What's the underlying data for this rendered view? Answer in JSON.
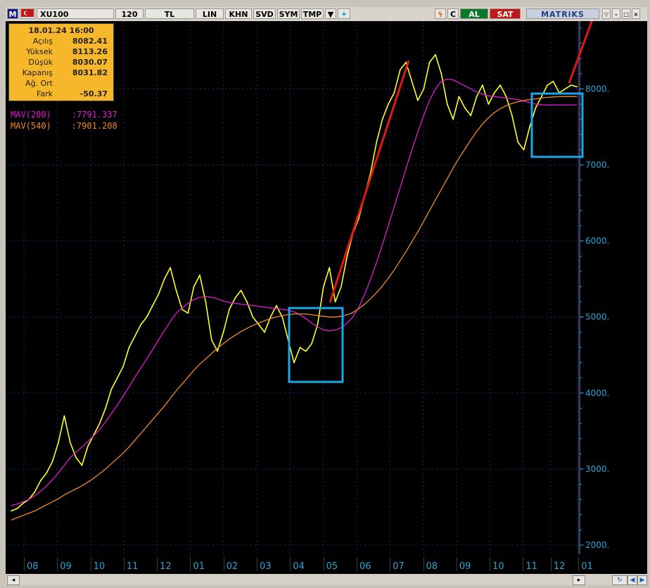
{
  "toolbar": {
    "logo": "M",
    "symbol": "XU100",
    "period": "120",
    "currency": "TL",
    "lin": "LIN",
    "khn": "KHN",
    "svd": "SVD",
    "sym": "SYM",
    "tmp": "TMP",
    "c_label": "C",
    "buy": "AL",
    "sell": "SAT",
    "brand": "MATRiKS"
  },
  "info": {
    "date": "18.01.24 16:00",
    "rows": [
      {
        "label": "Açılış",
        "value": "8082.41"
      },
      {
        "label": "Yüksek",
        "value": "8113.26"
      },
      {
        "label": "Düşük",
        "value": "8030.07"
      },
      {
        "label": "Kapanış",
        "value": "8031.82"
      },
      {
        "label": "Ağ. Ort",
        "value": ""
      },
      {
        "label": "Fark",
        "value": "-50.37"
      }
    ]
  },
  "indicators": {
    "mav200": {
      "label": "MAV(200)",
      "value": ":7791.337",
      "color": "#e01ad0"
    },
    "mav540": {
      "label": "MAV(540)",
      "value": ":7901.208",
      "color": "#f08a28"
    }
  },
  "colors": {
    "price": "#ffff22",
    "mav200": "#e01ad0",
    "mav540": "#f08a28",
    "axis": "#25a5d6",
    "boxes": "#1ea6e8",
    "trend": "#e01818"
  },
  "chart_data": {
    "type": "line",
    "ylim": [
      2000,
      8800
    ],
    "y_ticks": [
      "2000.",
      "3000.",
      "4000.",
      "5000.",
      "6000.",
      "7000.",
      "8000."
    ],
    "y_tick_values": [
      2000,
      3000,
      4000,
      5000,
      6000,
      7000,
      8000
    ],
    "x_ticks": [
      "08",
      "09",
      "10",
      "11",
      "12",
      "01",
      "02",
      "03",
      "04",
      "05",
      "06",
      "07",
      "08",
      "09",
      "10",
      "11",
      "12",
      "01"
    ],
    "n_points": 97,
    "x_tick_indices": [
      0,
      6,
      12,
      18,
      24,
      30,
      36,
      42,
      48,
      54,
      60,
      66,
      72,
      78,
      84,
      90,
      95,
      100
    ],
    "series": [
      {
        "name": "XU100",
        "values": [
          2450,
          2480,
          2550,
          2600,
          2700,
          2850,
          2950,
          3100,
          3350,
          3700,
          3350,
          3150,
          3050,
          3300,
          3450,
          3600,
          3800,
          4050,
          4200,
          4350,
          4600,
          4750,
          4900,
          5000,
          5150,
          5300,
          5500,
          5650,
          5350,
          5100,
          5050,
          5400,
          5550,
          5200,
          4700,
          4550,
          4800,
          5100,
          5250,
          5350,
          5200,
          5000,
          4900,
          4800,
          5000,
          5150,
          5000,
          4700,
          4400,
          4600,
          4550,
          4650,
          4900,
          5400,
          5650,
          5200,
          5400,
          5800,
          6100,
          6300,
          6600,
          6900,
          7300,
          7600,
          7800,
          7950,
          8250,
          8350,
          8100,
          7850,
          8000,
          8350,
          8450,
          8200,
          7800,
          7600,
          7900,
          7750,
          7650,
          7900,
          8050,
          7800,
          7950,
          8050,
          7900,
          7650,
          7300,
          7200,
          7500,
          7750,
          7900,
          8050,
          8100,
          7950,
          8000,
          8050,
          8030
        ]
      },
      {
        "name": "MAV(200)",
        "values": [
          2520,
          2540,
          2570,
          2600,
          2650,
          2710,
          2780,
          2860,
          2950,
          3050,
          3150,
          3220,
          3290,
          3360,
          3440,
          3520,
          3620,
          3730,
          3840,
          3960,
          4080,
          4210,
          4330,
          4450,
          4570,
          4700,
          4820,
          4940,
          5050,
          5120,
          5180,
          5230,
          5260,
          5270,
          5260,
          5240,
          5210,
          5190,
          5180,
          5170,
          5160,
          5150,
          5140,
          5130,
          5120,
          5110,
          5100,
          5090,
          5070,
          5030,
          4980,
          4920,
          4870,
          4830,
          4820,
          4830,
          4860,
          4920,
          5000,
          5130,
          5300,
          5500,
          5720,
          5950,
          6200,
          6450,
          6700,
          6950,
          7200,
          7430,
          7650,
          7850,
          8000,
          8100,
          8130,
          8120,
          8080,
          8040,
          8000,
          7960,
          7930,
          7910,
          7900,
          7890,
          7880,
          7870,
          7860,
          7840,
          7820,
          7800,
          7790,
          7790,
          7790,
          7790,
          7790,
          7791,
          7791
        ]
      },
      {
        "name": "MAV(540)",
        "values": [
          2330,
          2360,
          2390,
          2420,
          2450,
          2490,
          2530,
          2570,
          2610,
          2660,
          2700,
          2740,
          2780,
          2830,
          2880,
          2940,
          3000,
          3070,
          3140,
          3210,
          3290,
          3380,
          3470,
          3560,
          3650,
          3740,
          3830,
          3930,
          4030,
          4120,
          4210,
          4300,
          4380,
          4450,
          4520,
          4590,
          4650,
          4710,
          4760,
          4810,
          4850,
          4890,
          4920,
          4950,
          4980,
          5000,
          5020,
          5030,
          5040,
          5040,
          5040,
          5030,
          5020,
          5010,
          5000,
          5000,
          5010,
          5030,
          5060,
          5110,
          5170,
          5240,
          5320,
          5410,
          5510,
          5620,
          5740,
          5860,
          5990,
          6120,
          6260,
          6400,
          6540,
          6680,
          6820,
          6960,
          7090,
          7210,
          7330,
          7440,
          7540,
          7620,
          7690,
          7740,
          7780,
          7810,
          7830,
          7850,
          7860,
          7870,
          7880,
          7890,
          7895,
          7898,
          7900,
          7901,
          7901
        ]
      }
    ]
  }
}
